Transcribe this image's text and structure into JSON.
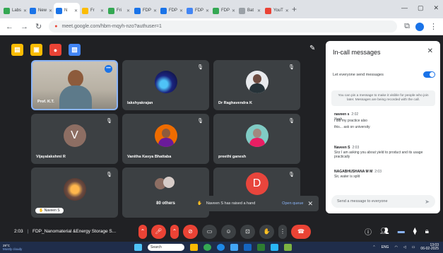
{
  "browser": {
    "tabs": [
      {
        "label": "Labs",
        "color": "#34a853"
      },
      {
        "label": "New",
        "color": "#1a73e8"
      },
      {
        "label": "N",
        "color": "#1a73e8",
        "active": true
      },
      {
        "label": "Fr",
        "color": "#fbbc04"
      },
      {
        "label": "Fri",
        "color": "#34a853"
      },
      {
        "label": "FDP",
        "color": "#1a73e8"
      },
      {
        "label": "FDP",
        "color": "#1a73e8"
      },
      {
        "label": "FDP",
        "color": "#4285f4"
      },
      {
        "label": "FDP",
        "color": "#34a853"
      },
      {
        "label": "Bat",
        "color": "#9aa0a6"
      },
      {
        "label": "YouT",
        "color": "#ea4335"
      }
    ],
    "url": "meet.google.com/hbm-mqyh-nzo?authuser=1"
  },
  "apps": [
    {
      "icon": "notes-icon",
      "color": "#fbbc04",
      "glyph": "▤"
    },
    {
      "icon": "keep-icon",
      "color": "#fbbc04",
      "glyph": "▣"
    },
    {
      "icon": "record-icon",
      "color": "#ea4335",
      "glyph": "●"
    },
    {
      "icon": "docs-icon",
      "color": "#4285f4",
      "glyph": "▧"
    }
  ],
  "participants": [
    {
      "name": "Prof. K.T.",
      "type": "video",
      "highlight": true
    },
    {
      "name": "lakshyakrajan",
      "type": "image-space"
    },
    {
      "name": "Dr Raghavendra K",
      "type": "photo-man"
    },
    {
      "name": "Vijayalakshmi R",
      "type": "letter",
      "letter": "V",
      "color": "#8d6e63"
    },
    {
      "name": "Vanitha Kavya Bhattaba",
      "type": "photo-woman"
    },
    {
      "name": "preethi ganesh",
      "type": "photo-woman2"
    },
    {
      "name": "Naveen S",
      "type": "photo-flower",
      "badge": true
    },
    {
      "name": "80 others",
      "type": "group"
    },
    {
      "name": "",
      "type": "letter",
      "letter": "D",
      "color": "#e8453c"
    }
  ],
  "raise_hand": {
    "text": "Naveen S has raised a hand",
    "action": "Open queue"
  },
  "chat": {
    "title": "In-call messages",
    "toggle_label": "Let everyone send messages",
    "info": "You can pin a message to make it visible for people who join later. Messages are being recorded with the call.",
    "messages": [
      {
        "who": "naveen s",
        "time": "2:02",
        "text": "Yeah"
      },
      {
        "who": "",
        "time": "",
        "text": "I did my practice also"
      },
      {
        "who": "",
        "time": "",
        "text": "this... ask on university"
      },
      {
        "who": "Naveen S",
        "time": "2:03",
        "text": "Sirz I am asking you about yield to product and its usage practically"
      },
      {
        "who": "NAGABHUSHANA M M",
        "time": "2:03",
        "text": "Sir, water is split"
      }
    ],
    "input_placeholder": "Send a message to everyone"
  },
  "meeting": {
    "time": "2:03",
    "title": "FDP_Nanomaterial &Energy Storage S..."
  },
  "taskbar": {
    "weather_temp": "29°C",
    "weather_desc": "Mostly cloudy",
    "search": "Search",
    "lang": "ENG",
    "time": "13:03",
    "date": "06-02-2025"
  }
}
